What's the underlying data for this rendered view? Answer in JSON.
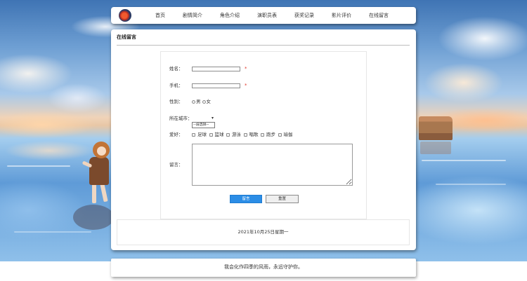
{
  "nav": {
    "logo_icon": "logo-icon",
    "items": [
      {
        "label": "首页"
      },
      {
        "label": "剧情简介"
      },
      {
        "label": "角色介绍"
      },
      {
        "label": "演职员表"
      },
      {
        "label": "获奖记录"
      },
      {
        "label": "影片评价"
      },
      {
        "label": "在线留言"
      }
    ]
  },
  "message_panel": {
    "title": "在线留言",
    "form": {
      "name": {
        "label": "姓名：",
        "required_mark": "*"
      },
      "phone": {
        "label": "手机：",
        "required_mark": "*"
      },
      "gender": {
        "label": "性别：",
        "options": [
          "男",
          "女"
        ]
      },
      "city": {
        "label": "所在城市：",
        "selected": "--请选择--",
        "arrow": "▾"
      },
      "hobbies": {
        "label": "爱好：",
        "options": [
          "足球",
          "篮球",
          "游泳",
          "唱歌",
          "跑步",
          "瑜伽"
        ]
      },
      "message": {
        "label": "留言："
      },
      "submit_label": "留言",
      "reset_label": "重置"
    },
    "date_text": "2021年10月25日星期一"
  },
  "footer": {
    "text": "我会化作四季的风雨，永远守护你。"
  },
  "colors": {
    "submit_button": "#2b8de6",
    "required_mark": "#e0382c",
    "reset_button": "#efefef",
    "panel_background": "#ffffff"
  }
}
